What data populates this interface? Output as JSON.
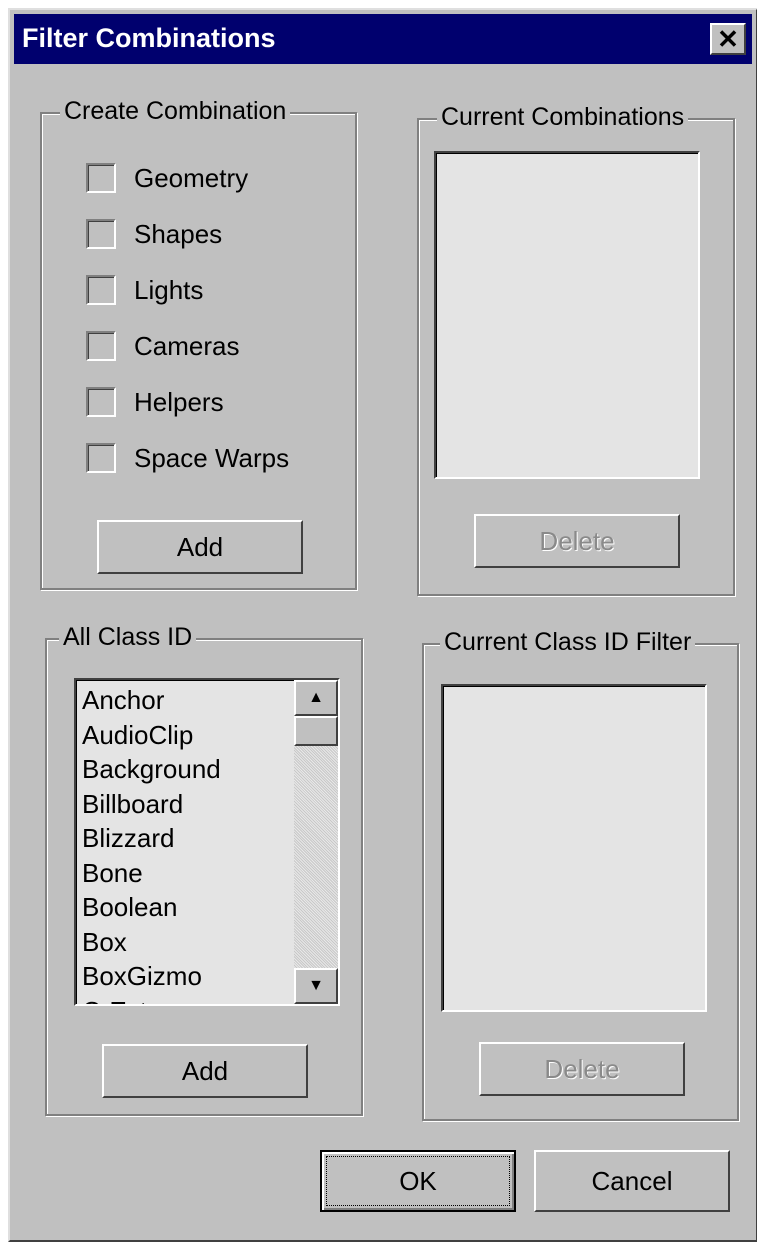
{
  "window": {
    "title": "Filter Combinations",
    "close_glyph": "✕"
  },
  "create_combination": {
    "label": "Create Combination",
    "checkboxes": [
      "Geometry",
      "Shapes",
      "Lights",
      "Cameras",
      "Helpers",
      "Space Warps"
    ],
    "add_label": "Add"
  },
  "current_combinations": {
    "label": "Current Combinations",
    "delete_label": "Delete"
  },
  "all_class_id": {
    "label": "All Class ID",
    "items": [
      "Anchor",
      "AudioClip",
      "Background",
      "Billboard",
      "Blizzard",
      "Bone",
      "Boolean",
      "Box",
      "BoxGizmo",
      "C-Ext"
    ],
    "add_label": "Add",
    "scroll_up_glyph": "▲",
    "scroll_down_glyph": "▼"
  },
  "current_class_id_filter": {
    "label": "Current Class ID Filter",
    "delete_label": "Delete"
  },
  "footer": {
    "ok_label": "OK",
    "cancel_label": "Cancel"
  }
}
